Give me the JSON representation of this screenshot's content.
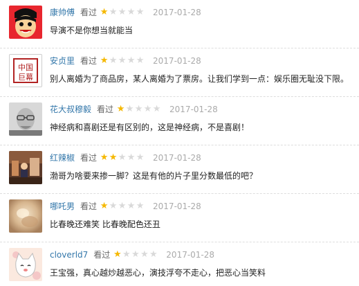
{
  "reviews": [
    {
      "username": "康帅傅",
      "status": "看过",
      "rating_stars": 1,
      "rating_max": 5,
      "date": "2017-01-28",
      "comment": "导演不是你想当就能当",
      "avatar_icon": "cartoon-boy-avatar"
    },
    {
      "username": "安贞里",
      "status": "看过",
      "rating_stars": 1,
      "rating_max": 5,
      "date": "2017-01-28",
      "comment": "别人离婚为了商品房，某人离婚为了票房。让我们学到一点：娱乐圈无耻没下限。",
      "avatar_icon": "zhongguo-jumu-logo-avatar",
      "avatar_text": "中国巨幕"
    },
    {
      "username": "花大叔穆毅",
      "status": "看过",
      "rating_stars": 1,
      "rating_max": 5,
      "date": "2017-01-28",
      "comment": "神经病和喜剧还是有区别的，这是神经病，不是喜剧！",
      "avatar_icon": "man-with-glasses-avatar"
    },
    {
      "username": "红辣椒",
      "status": "看过",
      "rating_stars": 2,
      "rating_max": 5,
      "date": "2017-01-28",
      "comment": "渤哥为啥要来掺一脚？这是有他的片子里分数最低的吧？",
      "avatar_icon": "stage-scene-avatar"
    },
    {
      "username": "哪吒男",
      "status": "看过",
      "rating_stars": 1,
      "rating_max": 5,
      "date": "2017-01-28",
      "comment": "比春晚还难笑 比春晚配色还丑",
      "avatar_icon": "blurry-photo-avatar"
    },
    {
      "username": "cloverld7",
      "status": "看过",
      "rating_stars": 1,
      "rating_max": 5,
      "date": "2017-01-28",
      "comment": "王宝强，真心越炒越恶心，演技浮夸不走心，把恶心当笑料",
      "avatar_icon": "white-cat-cartoon-avatar"
    }
  ],
  "colors": {
    "username": "#3377aa",
    "star_on": "#f5b800",
    "star_off": "#d9d9d9",
    "date": "#aaaaaa"
  }
}
